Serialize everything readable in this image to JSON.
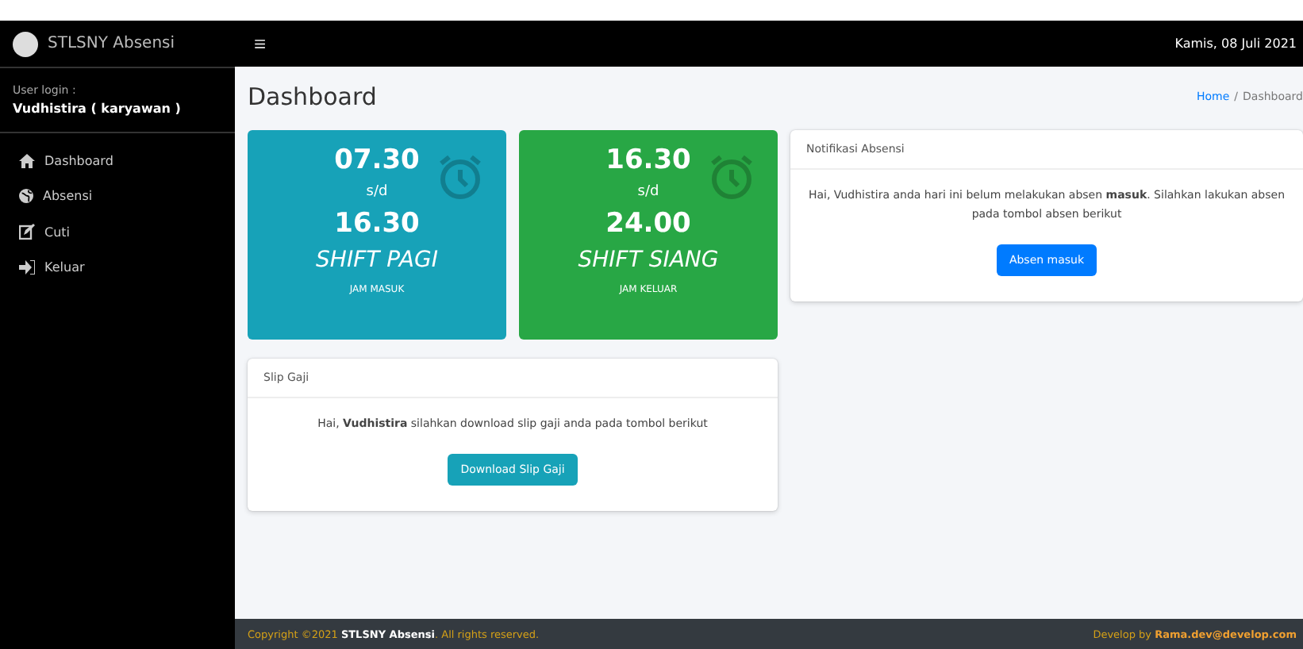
{
  "sidebar": {
    "brand": "STLSNY Absensi",
    "user_label": "User login :",
    "user_name": "Vudhistira ( karyawan )",
    "items": [
      {
        "label": "Dashboard",
        "kind": "home"
      },
      {
        "label": "Absensi",
        "kind": "globe"
      },
      {
        "label": "Cuti",
        "kind": "edit"
      },
      {
        "label": "Keluar",
        "kind": "exit"
      }
    ]
  },
  "topbar": {
    "menu": "≡",
    "date": "Kamis, 08 Juli 2021"
  },
  "header": {
    "title": "Dashboard",
    "breadcrumb_separator": "/",
    "breadcrumb": [
      {
        "label": "Home",
        "kind": "link"
      },
      {
        "label": "Dashboard",
        "kind": "current"
      }
    ]
  },
  "shifts": [
    {
      "start": "07.30",
      "sep": "s/d",
      "end": "16.30",
      "name": "SHIFT PAGI",
      "footer": "JAM MASUK",
      "color": "#17a2b8"
    },
    {
      "start": "16.30",
      "sep": "s/d",
      "end": "24.00",
      "name": "SHIFT SIANG",
      "footer": "JAM KELUAR",
      "color": "#28a745"
    }
  ],
  "notification": {
    "title": "Notifikasi Absensi",
    "text": "Hai, Vudhistira anda hari ini belum melakukan absen **masuk**. Silahkan lakukan absen pada tombol absen berikut",
    "button": "Absen masuk"
  },
  "slip": {
    "title": "Slip Gaji",
    "text": "Hai, **Vudhistira** silahkan download slip gaji anda pada tombol berikut",
    "button": "Download Slip Gaji"
  },
  "footer": {
    "left": "Copyright ©2021 **STLSNY Absensi**. All rights reserved.",
    "right": "Develop by **Rama.dev@develop.com**"
  }
}
